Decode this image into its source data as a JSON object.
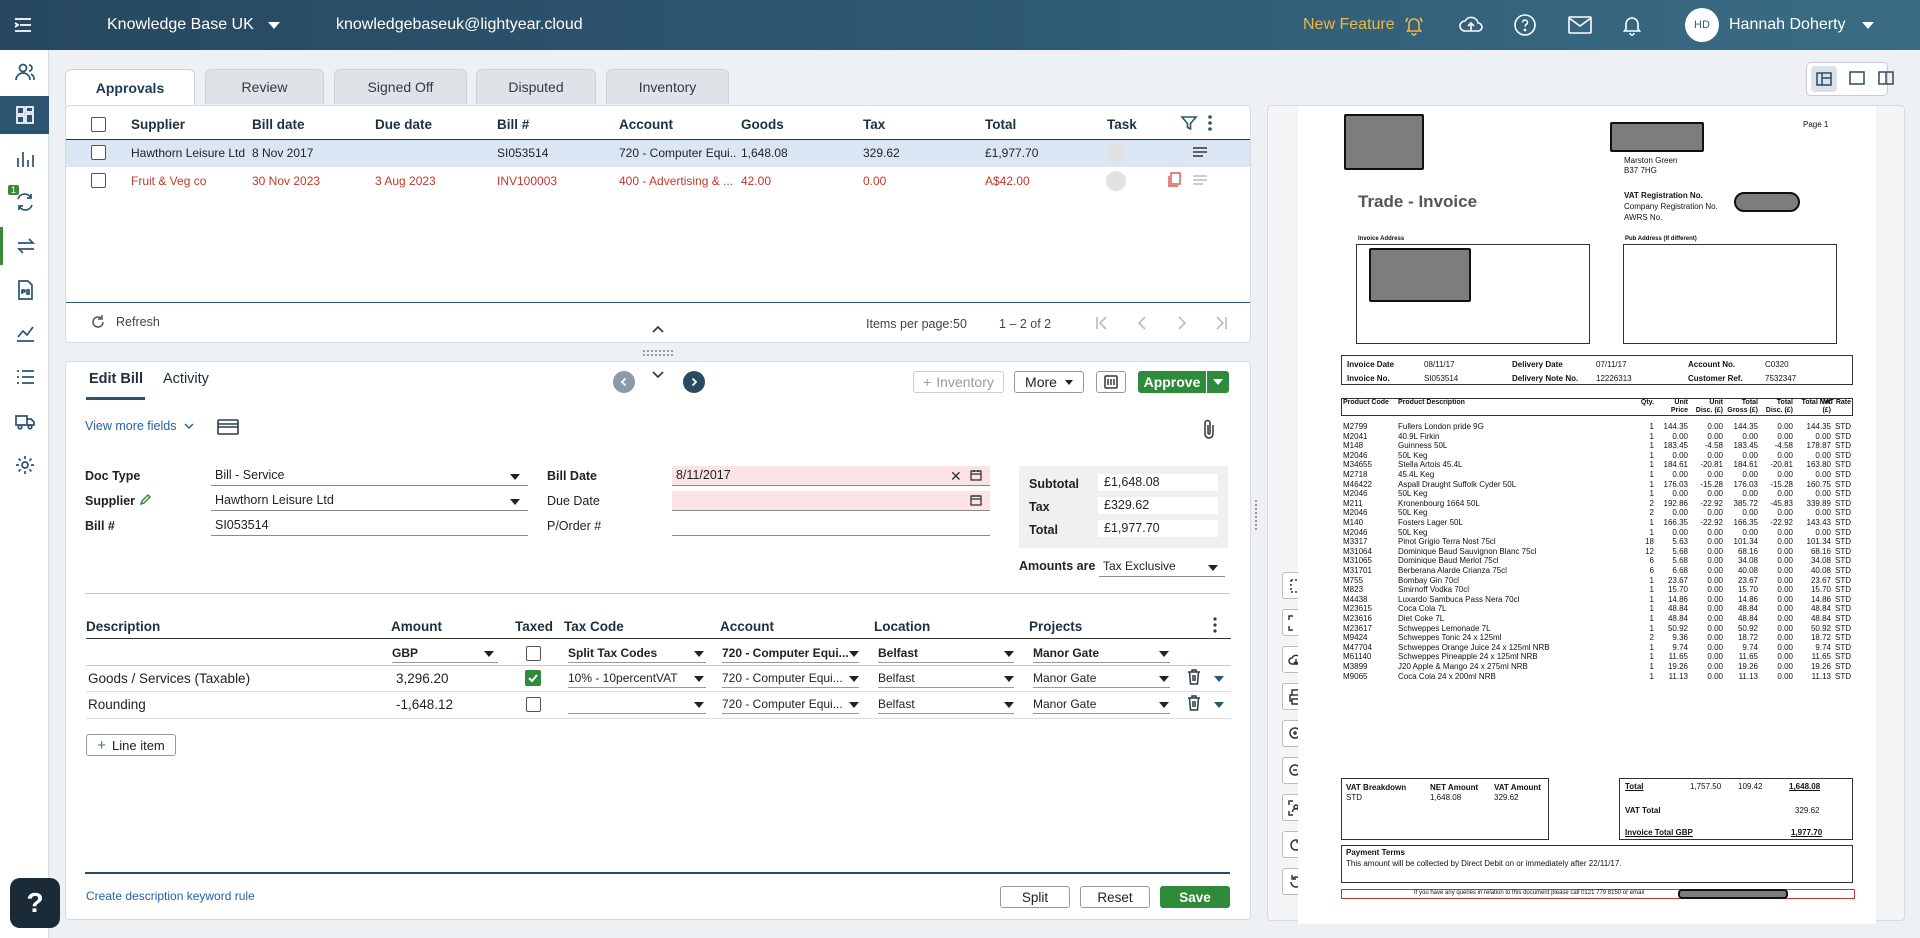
{
  "topbar": {
    "org_name": "Knowledge Base UK",
    "email": "knowledgebaseuk@lightyear.cloud",
    "new_feature": "New Feature",
    "avatar_initials": "HD",
    "user_name": "Hannah Doherty"
  },
  "sidebar": {
    "badge": "1",
    "items": [
      "contacts-icon",
      "dashboard-icon",
      "bar-chart-icon",
      "sync-icon",
      "transfer-icon",
      "po-icon",
      "line-chart-icon",
      "list-icon",
      "truck-icon",
      "settings-icon"
    ]
  },
  "tabs": [
    "Approvals",
    "Review",
    "Signed Off",
    "Disputed",
    "Inventory"
  ],
  "grid": {
    "headers": [
      "Supplier",
      "Bill date",
      "Due date",
      "Bill #",
      "Account",
      "Goods",
      "Tax",
      "Total",
      "Task"
    ],
    "rows": [
      {
        "supplier": "Hawthorn Leisure Ltd",
        "bill_date": "8 Nov 2017",
        "due_date": "",
        "bill_no": "SI053514",
        "account": "720 - Computer Equi...",
        "goods": "1,648.08",
        "tax": "329.62",
        "total": "£1,977.70"
      },
      {
        "supplier": "Fruit & Veg co",
        "bill_date": "30 Nov 2023",
        "due_date": "3 Aug 2023",
        "bill_no": "INV100003",
        "account": "400 - Advertising & ...",
        "goods": "42.00",
        "tax": "0.00",
        "total": "A$42.00"
      }
    ],
    "refresh": "Refresh",
    "items_per_page_label": "Items per page:",
    "items_per_page": "50",
    "range": "1 – 2 of 2"
  },
  "editor": {
    "tab_edit": "Edit Bill",
    "tab_activity": "Activity",
    "inventory_btn": "Inventory",
    "more_btn": "More",
    "approve_btn": "Approve",
    "view_more": "View more fields",
    "doc_type_label": "Doc Type",
    "doc_type": "Bill - Service",
    "supplier_label": "Supplier",
    "supplier": "Hawthorn Leisure Ltd",
    "bill_no_label": "Bill #",
    "bill_no": "SI053514",
    "bill_date_label": "Bill Date",
    "bill_date": "8/11/2017",
    "due_date_label": "Due Date",
    "due_date": "",
    "porder_label": "P/Order #",
    "porder": "",
    "subtotal_label": "Subtotal",
    "subtotal": "£1,648.08",
    "tax_label": "Tax",
    "tax": "£329.62",
    "total_label": "Total",
    "total": "£1,977.70",
    "amounts_are_label": "Amounts are",
    "amounts_are": "Tax Exclusive"
  },
  "lines": {
    "headers": [
      "Description",
      "Amount",
      "Taxed",
      "Tax Code",
      "Account",
      "Location",
      "Projects"
    ],
    "defaults": {
      "currency": "GBP",
      "tax_code": "Split Tax Codes",
      "account": "720 - Computer Equi...",
      "location": "Belfast",
      "project": "Manor Gate"
    },
    "rows": [
      {
        "description": "Goods / Services (Taxable)",
        "amount": "3,296.20",
        "taxed": true,
        "tax_code": "10% - 10percentVAT",
        "account": "720 - Computer Equi...",
        "location": "Belfast",
        "project": "Manor Gate"
      },
      {
        "description": "Rounding",
        "amount": "-1,648.12",
        "taxed": false,
        "tax_code": "",
        "account": "720 - Computer Equi...",
        "location": "Belfast",
        "project": "Manor Gate"
      }
    ],
    "line_item_btn": "Line item",
    "keyword_rule": "Create description keyword rule",
    "split_btn": "Split",
    "reset_btn": "Reset",
    "save_btn": "Save"
  },
  "help": "?",
  "invoice": {
    "page": "Page  1",
    "title": "Trade - Invoice",
    "addr1": "Marston Green",
    "addr2": "B37 7HG",
    "vat_reg": "VAT Registration No.",
    "company_reg": "Company Registration No.",
    "awrs": "AWRS No.",
    "invoice_address": "Invoice Address",
    "pub_address": "Pub Address (If different)",
    "invoice_date_label": "Invoice Date",
    "invoice_date": "08/11/17",
    "delivery_date_label": "Delivery Date",
    "delivery_date": "07/11/17",
    "account_no_label": "Account No.",
    "account_no": "C0320",
    "invoice_no_label": "Invoice No.",
    "invoice_no": "SI053514",
    "delivery_note_label": "Delivery Note No.",
    "delivery_note": "12226313",
    "customer_ref_label": "Customer Ref.",
    "customer_ref": "7532347",
    "columns": [
      "Product Code",
      "Product Description",
      "Qty.",
      "Unit Price",
      "Unit Disc. (£)",
      "Total Gross (£)",
      "Total Disc. (£)",
      "Total Net (£)",
      "VAT Rate"
    ],
    "items": [
      [
        "M2799",
        "Fullers London pride 9G",
        "1",
        "144.35",
        "0.00",
        "144.35",
        "0.00",
        "144.35",
        "STD"
      ],
      [
        "M2041",
        "40.9L Firkin",
        "1",
        "0.00",
        "0.00",
        "0.00",
        "0.00",
        "0.00",
        "STD"
      ],
      [
        "M148",
        "Guinness  50L",
        "1",
        "183.45",
        "-4.58",
        "183.45",
        "-4.58",
        "178.87",
        "STD"
      ],
      [
        "M2046",
        "50L Keg",
        "1",
        "0.00",
        "0.00",
        "0.00",
        "0.00",
        "0.00",
        "STD"
      ],
      [
        "M34655",
        "Stella Artois  45.4L",
        "1",
        "184.61",
        "-20.81",
        "184.61",
        "-20.81",
        "163.80",
        "STD"
      ],
      [
        "M2718",
        "45.4L Keg",
        "1",
        "0.00",
        "0.00",
        "0.00",
        "0.00",
        "0.00",
        "STD"
      ],
      [
        "M46422",
        "Aspall Draught Suffolk Cyder 50L",
        "1",
        "176.03",
        "-15.28",
        "176.03",
        "-15.28",
        "160.75",
        "STD"
      ],
      [
        "M2046",
        "50L Keg",
        "1",
        "0.00",
        "0.00",
        "0.00",
        "0.00",
        "0.00",
        "STD"
      ],
      [
        "M211",
        "Kronenbourg 1664  50L",
        "2",
        "192.86",
        "-22.92",
        "385.72",
        "-45.83",
        "339.89",
        "STD"
      ],
      [
        "M2046",
        "50L Keg",
        "2",
        "0.00",
        "0.00",
        "0.00",
        "0.00",
        "0.00",
        "STD"
      ],
      [
        "M140",
        "Fosters Lager  50L",
        "1",
        "166.35",
        "-22.92",
        "166.35",
        "-22.92",
        "143.43",
        "STD"
      ],
      [
        "M2046",
        "50L Keg",
        "1",
        "0.00",
        "0.00",
        "0.00",
        "0.00",
        "0.00",
        "STD"
      ],
      [
        "M3317",
        "Pinot Grigio Terra Nost  75cl",
        "18",
        "5.63",
        "0.00",
        "101.34",
        "0.00",
        "101.34",
        "STD"
      ],
      [
        "M31064",
        "Dominique Baud Sauvignon Blanc  75cl",
        "12",
        "5.68",
        "0.00",
        "68.16",
        "0.00",
        "68.16",
        "STD"
      ],
      [
        "M31065",
        "Dominique Baud Merlot  75cl",
        "6",
        "5.68",
        "0.00",
        "34.08",
        "0.00",
        "34.08",
        "STD"
      ],
      [
        "M31701",
        "Berberana Alarde Crianza  75cl",
        "6",
        "6.68",
        "0.00",
        "40.08",
        "0.00",
        "40.08",
        "STD"
      ],
      [
        "M755",
        "Bombay Gin  70cl",
        "1",
        "23.67",
        "0.00",
        "23.67",
        "0.00",
        "23.67",
        "STD"
      ],
      [
        "M823",
        "Smirnoff Vodka  70cl",
        "1",
        "15.70",
        "0.00",
        "15.70",
        "0.00",
        "15.70",
        "STD"
      ],
      [
        "M4438",
        "Luxardo Sambuca Pass Nera  70cl",
        "1",
        "14.86",
        "0.00",
        "14.86",
        "0.00",
        "14.86",
        "STD"
      ],
      [
        "M23615",
        "Coca Cola  7L",
        "1",
        "48.84",
        "0.00",
        "48.84",
        "0.00",
        "48.84",
        "STD"
      ],
      [
        "M23616",
        "Diet Coke  7L",
        "1",
        "48.84",
        "0.00",
        "48.84",
        "0.00",
        "48.84",
        "STD"
      ],
      [
        "M23617",
        "Schweppes Lemonade  7L",
        "1",
        "50.92",
        "0.00",
        "50.92",
        "0.00",
        "50.92",
        "STD"
      ],
      [
        "M9424",
        "Schweppes Tonic 24 x 125ml",
        "2",
        "9.36",
        "0.00",
        "18.72",
        "0.00",
        "18.72",
        "STD"
      ],
      [
        "M47704",
        "Schweppes Orange Juice  24 x 125ml NRB",
        "1",
        "9.74",
        "0.00",
        "9.74",
        "0.00",
        "9.74",
        "STD"
      ],
      [
        "M61140",
        "Schweppes Pineapple  24 x 125ml NRB",
        "1",
        "11.65",
        "0.00",
        "11.65",
        "0.00",
        "11.65",
        "STD"
      ],
      [
        "M3899",
        "J20 Apple & Mango  24 x 275ml NRB",
        "1",
        "19.26",
        "0.00",
        "19.26",
        "0.00",
        "19.26",
        "STD"
      ],
      [
        "M9065",
        "Coca Cola  24 x 200ml NRB",
        "1",
        "11.13",
        "0.00",
        "11.13",
        "0.00",
        "11.13",
        "STD"
      ]
    ],
    "vat_breakdown": "VAT Breakdown",
    "net_amount": "NET Amount",
    "vat_amount": "VAT Amount",
    "std": "STD",
    "std_net": "1,648.08",
    "std_vat": "329.62",
    "total_label": "Total",
    "total_gross": "1,757.50",
    "total_disc": "109.42",
    "total_net": "1,648.08",
    "vat_total_label": "VAT Total",
    "vat_total": "329.62",
    "invoice_total_label": "Invoice Total GBP",
    "invoice_total": "1,977.70",
    "payment_terms": "Payment Terms",
    "payment_text": "This amount will be collected by Direct Debit  on or immediately after 22/11/17.",
    "footer": "If you have any queries in relation to this document please call 0121 779 8150 or email"
  },
  "colors": {
    "accent": "#2e8b3a",
    "topbar": "#2f5a74",
    "selected_row": "#dbe6f5",
    "error": "#c0392b",
    "pink_field": "#fbe3e6"
  }
}
